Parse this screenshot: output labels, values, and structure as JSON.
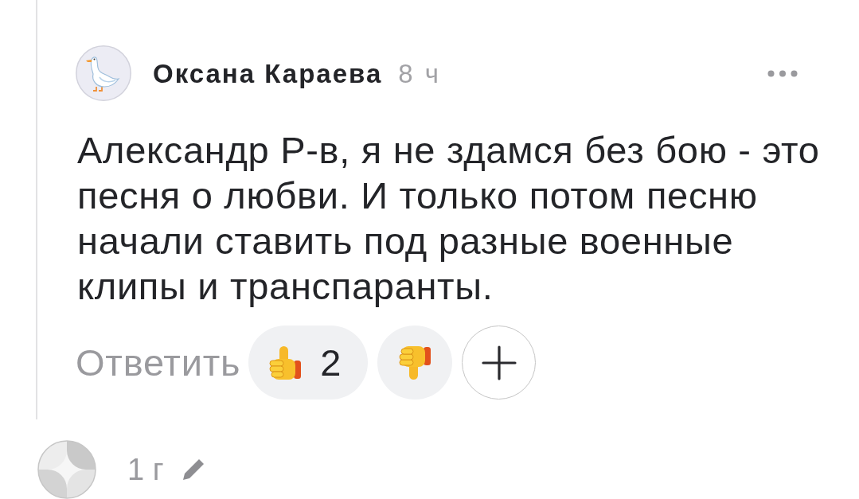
{
  "comment": {
    "author": "Оксана Караева",
    "time": "8 ч",
    "text": "Александр Р-в, я не здамся без бою - это песня о любви. И только потом песню начали ставить под разные военные клипы и транспаранты.",
    "actions": {
      "reply": "Ответить",
      "like_count": "2"
    }
  },
  "next_comment": {
    "time": "1 г"
  }
}
